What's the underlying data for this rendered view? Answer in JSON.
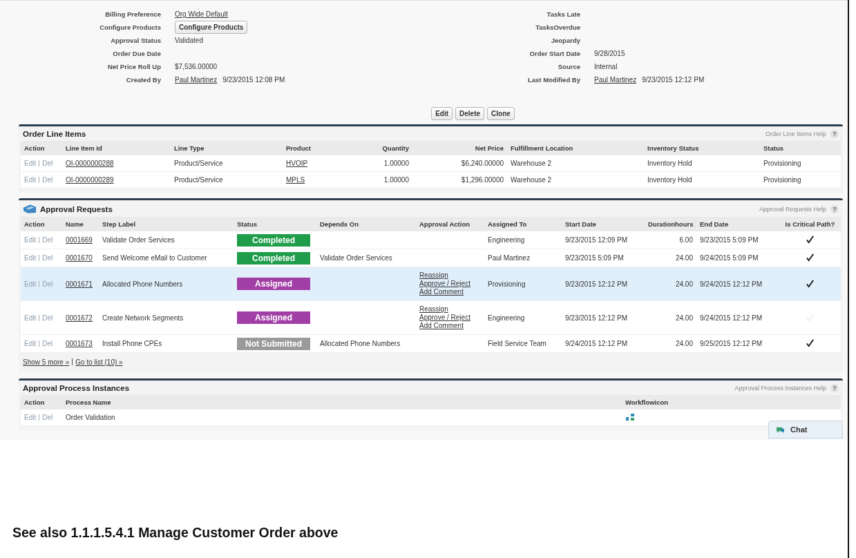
{
  "details": {
    "left": [
      {
        "label": "Billing Preference",
        "kind": "link",
        "value": "Org Wide Default"
      },
      {
        "label": "Configure Products",
        "kind": "button",
        "value": "Configure Products"
      },
      {
        "label": "Approval Status",
        "kind": "text",
        "value": "Validated"
      },
      {
        "label": "Order Due Date",
        "kind": "text"
      },
      {
        "label": "Net Price Roll Up",
        "kind": "text",
        "value": "$7,536.00000"
      },
      {
        "label": "Created By",
        "kind": "link",
        "value": "Paul Martinez",
        "extra": "9/23/2015 12:08 PM"
      }
    ],
    "right": [
      {
        "label": "Tasks Late",
        "kind": "text"
      },
      {
        "label": "TasksOverdue",
        "kind": "text"
      },
      {
        "label": "Jeopardy",
        "kind": "text"
      },
      {
        "label": "Order Start Date",
        "kind": "text",
        "value": "9/28/2015"
      },
      {
        "label": "Source",
        "kind": "text",
        "value": "Internal"
      },
      {
        "label": "Last Modified By",
        "kind": "link",
        "value": "Paul Martinez",
        "extra": "9/23/2015 12:12 PM"
      }
    ],
    "buttons": [
      "Edit",
      "Delete",
      "Clone"
    ]
  },
  "order_line_items": {
    "title": "Order Line Items",
    "help": "Order Line Items Help",
    "help_icon": "?",
    "columns": [
      "Action",
      "Line Item Id",
      "Line Type",
      "Product",
      "Quantity",
      "Net Price",
      "Fulfillment Location",
      "Inventory Status",
      "Status"
    ],
    "rows": [
      {
        "edit": "Edit",
        "del": "Del",
        "id": "OI-0000000288",
        "line_type": "Product/Service",
        "product": "HVOIP",
        "quantity": "1.00000",
        "net_price": "$6,240.00000",
        "location": "Warehouse 2",
        "inventory_status": "Inventory Hold",
        "status": "Provisioning"
      },
      {
        "edit": "Edit",
        "del": "Del",
        "id": "OI-0000000289",
        "line_type": "Product/Service",
        "product": "MPLS",
        "quantity": "1.00000",
        "net_price": "$1,296.00000",
        "location": "Warehouse 2",
        "inventory_status": "Inventory Hold",
        "status": "Provisioning"
      }
    ]
  },
  "approval_requests": {
    "title": "Approval Requests",
    "help": "Approval Requests Help",
    "help_icon": "?",
    "columns": [
      "Action",
      "Name",
      "Step Label",
      "Status",
      "Depends On",
      "Approval Action",
      "Assigned To",
      "Start Date",
      "Durationhours",
      "End Date",
      "Is Critical Path?"
    ],
    "rows": [
      {
        "edit": "Edit",
        "del": "Del",
        "name": "0001669",
        "step": "Validate Order Services",
        "status": {
          "label": "Completed",
          "kind": "completed"
        },
        "depends_on": "",
        "actions": [],
        "assigned_to": "Engineering",
        "start": "9/23/2015 12:09 PM",
        "duration": "6.00",
        "end": "9/23/2015 5:09 PM",
        "critical": true,
        "selected": false
      },
      {
        "edit": "Edit",
        "del": "Del",
        "name": "0001670",
        "step": "Send Welcome eMail to Customer",
        "status": {
          "label": "Completed",
          "kind": "completed"
        },
        "depends_on": "Validate Order Services",
        "actions": [],
        "assigned_to": "Paul Martinez",
        "start": "9/23/2015 5:09 PM",
        "duration": "24.00",
        "end": "9/24/2015 5:09 PM",
        "critical": true,
        "selected": false
      },
      {
        "edit": "Edit",
        "del": "Del",
        "name": "0001671",
        "step": "Allocated Phone Numbers",
        "status": {
          "label": "Assigned",
          "kind": "assigned"
        },
        "depends_on": "",
        "actions": [
          "Reassign",
          "Approve / Reject",
          "Add Comment"
        ],
        "assigned_to": "Provisioning",
        "start": "9/23/2015 12:12 PM",
        "duration": "24.00",
        "end": "9/24/2015 12:12 PM",
        "critical": true,
        "selected": true
      },
      {
        "edit": "Edit",
        "del": "Del",
        "name": "0001672",
        "step": "Create Network Segments",
        "status": {
          "label": "Assigned",
          "kind": "assigned"
        },
        "depends_on": "",
        "actions": [
          "Reassign",
          "Approve / Reject",
          "Add Comment"
        ],
        "assigned_to": "Engineering",
        "start": "9/23/2015 12:12 PM",
        "duration": "24.00",
        "end": "9/24/2015 12:12 PM",
        "critical": false,
        "selected": false
      },
      {
        "edit": "Edit",
        "del": "Del",
        "name": "0001673",
        "step": "Install Phone CPEs",
        "status": {
          "label": "Not Submitted",
          "kind": "not_submitted"
        },
        "depends_on": "Allocated Phone Numbers",
        "actions": [],
        "assigned_to": "Field Service Team",
        "start": "9/24/2015 12:12 PM",
        "duration": "24.00",
        "end": "9/25/2015 12:12 PM",
        "critical": true,
        "selected": false
      }
    ],
    "show_more": "Show 5 more »",
    "go_to_list": "Go to list (10) »"
  },
  "approval_process_instances": {
    "title": "Approval Process Instances",
    "help": "Approval Process Instances Help",
    "help_icon": "?",
    "columns": [
      "Action",
      "Process Name",
      "Workflowicon"
    ],
    "rows": [
      {
        "edit": "Edit",
        "del": "Del",
        "process_name": "Order Validation"
      }
    ]
  },
  "chat": {
    "label": "Chat"
  },
  "heading": "See also 1.1.1.5.4.1 Manage Customer Order above"
}
